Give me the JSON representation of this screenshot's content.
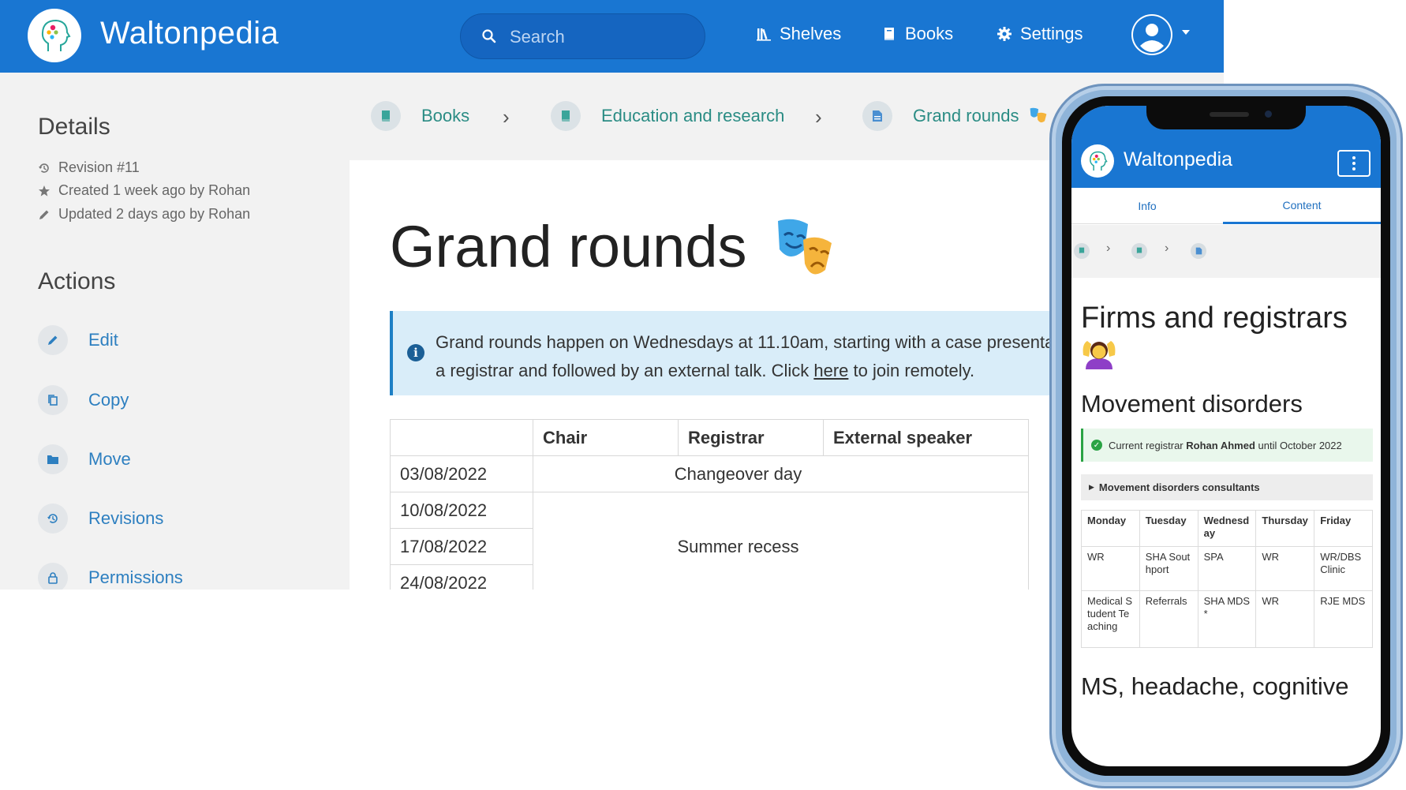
{
  "app": {
    "name": "Waltonpedia"
  },
  "header": {
    "search_placeholder": "Search",
    "nav": [
      {
        "label": "Shelves",
        "icon": "shelves-icon"
      },
      {
        "label": "Books",
        "icon": "book-icon"
      },
      {
        "label": "Settings",
        "icon": "gear-icon"
      }
    ]
  },
  "sidebar": {
    "details_heading": "Details",
    "meta": [
      {
        "icon": "history-icon",
        "text": "Revision #11"
      },
      {
        "icon": "star-icon",
        "text": "Created 1 week ago by Rohan"
      },
      {
        "icon": "pencil-icon",
        "text": "Updated 2 days ago by Rohan"
      }
    ],
    "actions_heading": "Actions",
    "actions": [
      {
        "icon": "pencil-icon",
        "label": "Edit"
      },
      {
        "icon": "copy-icon",
        "label": "Copy"
      },
      {
        "icon": "folder-icon",
        "label": "Move"
      },
      {
        "icon": "history-icon",
        "label": "Revisions"
      },
      {
        "icon": "lock-icon",
        "label": "Permissions"
      }
    ]
  },
  "breadcrumbs": [
    {
      "label": "Books",
      "icon": "book-icon"
    },
    {
      "label": "Education and research",
      "icon": "book-icon"
    },
    {
      "label": "Grand rounds",
      "icon": "page-icon"
    }
  ],
  "page": {
    "title": "Grand rounds",
    "callout_line1": "Grand rounds happen on Wednesdays at 11.10am, starting with a case presentation from",
    "callout_line2_pre": "a registrar and followed by an external talk. Click ",
    "callout_link": "here",
    "callout_line2_post": " to join remotely.",
    "table": {
      "headers": [
        "",
        "Chair",
        "Registrar",
        "External speaker"
      ],
      "rows": [
        {
          "date": "03/08/2022",
          "note": "Changeover day"
        },
        {
          "date": "10/08/2022",
          "note": ""
        },
        {
          "date": "17/08/2022",
          "note": "Summer recess"
        },
        {
          "date": "24/08/2022",
          "note": ""
        }
      ]
    }
  },
  "mobile": {
    "app_name": "Waltonpedia",
    "tabs": [
      "Info",
      "Content"
    ],
    "active_tab": "Content",
    "h1": "Firms and registrars",
    "h2": "Movement disorders",
    "success_pre": "Current registrar ",
    "success_name": "Rohan Ahmed",
    "success_post": " until October 2022",
    "details_summary": "Movement disorders consultants",
    "table": {
      "headers": [
        "Monday",
        "Tuesday",
        "Wednesday",
        "Thursday",
        "Friday"
      ],
      "rows": [
        [
          "WR",
          "SHA Southport",
          "SPA",
          "WR",
          "WR/DBS Clinic"
        ],
        [
          "Medical Student Teaching",
          "Referrals",
          "SHA MDS*",
          "WR",
          "RJE MDS"
        ]
      ]
    },
    "h2b": "MS, headache, cognitive"
  },
  "colors": {
    "brand": "#1976d2",
    "link": "#2d7fc0",
    "crumb": "#2a8c84",
    "callout_bg": "#d9edf9",
    "success": "#2aa344"
  }
}
